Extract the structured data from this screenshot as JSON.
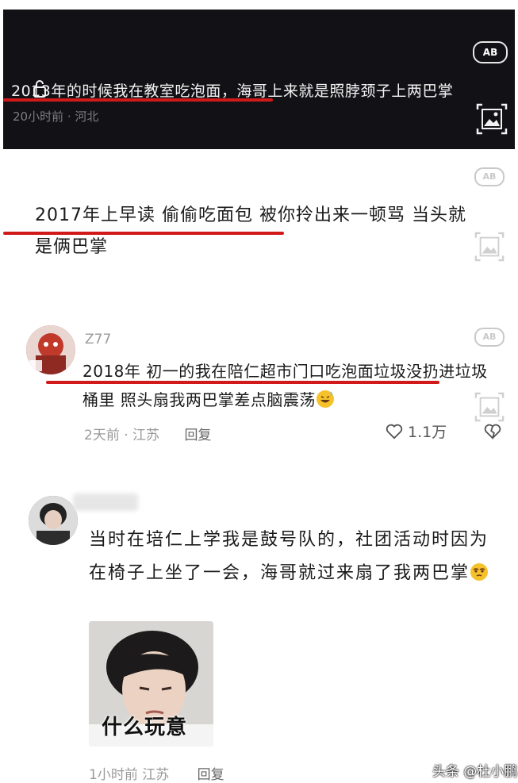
{
  "comment1": {
    "text": "2013年的时候我在教室吃泡面，海哥上来就是照脖颈子上两巴掌",
    "meta": "20小时前 · 河北",
    "translate_label": "AB"
  },
  "comment2": {
    "text": "2017年上早读 偷偷吃面包 被你拎出来一顿骂 当头就是俩巴掌",
    "translate_label": "AB"
  },
  "comment3": {
    "username": "Z77",
    "text": "2018年 初一的我在陪仁超市门口吃泡面垃圾没扔进垃圾桶里 照头扇我两巴掌差点脑震荡",
    "meta": "2天前 · 江苏",
    "reply_label": "回复",
    "like_count": "1.1万",
    "translate_label": "AB"
  },
  "comment4": {
    "text": "当时在培仁上学我是鼓号队的，社团活动时因为在椅子上坐了一会，海哥就过来扇了我两巴掌",
    "image_caption": "什么玩意",
    "meta": "1小时前 江苏",
    "reply_label": "回复"
  },
  "watermark": "头条 @杜小鹏",
  "colors": {
    "highlight_red": "#d21919",
    "dark_panel": "#121216"
  }
}
